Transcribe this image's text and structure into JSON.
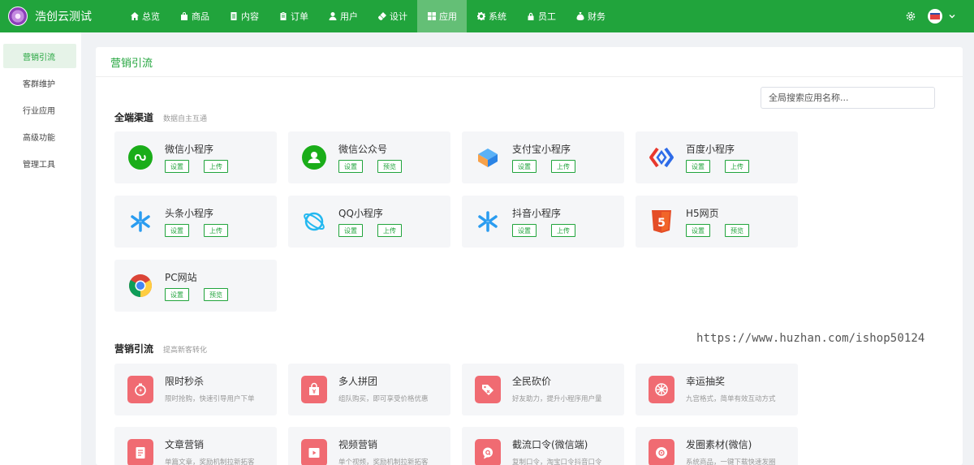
{
  "app": {
    "name": "浩创云测试"
  },
  "nav": [
    {
      "label": "总览",
      "icon": "home-icon"
    },
    {
      "label": "商品",
      "icon": "bag-icon"
    },
    {
      "label": "内容",
      "icon": "document-icon"
    },
    {
      "label": "订单",
      "icon": "clipboard-icon"
    },
    {
      "label": "用户",
      "icon": "user-icon"
    },
    {
      "label": "设计",
      "icon": "brush-icon"
    },
    {
      "label": "应用",
      "icon": "grid-icon",
      "active": true
    },
    {
      "label": "系统",
      "icon": "gear-icon"
    },
    {
      "label": "员工",
      "icon": "lock-icon"
    },
    {
      "label": "财务",
      "icon": "moneybag-icon"
    }
  ],
  "sidebar": [
    {
      "label": "营销引流",
      "active": true
    },
    {
      "label": "客群维护"
    },
    {
      "label": "行业应用"
    },
    {
      "label": "高级功能"
    },
    {
      "label": "管理工具"
    }
  ],
  "main": {
    "title": "营销引流",
    "search_placeholder": "全局搜索应用名称..."
  },
  "channels": {
    "title": "全端渠道",
    "subtitle": "数据自主互通",
    "items": [
      {
        "name": "微信小程序",
        "icon": "wechat-miniprogram-icon",
        "b1": "设置",
        "b2": "上传"
      },
      {
        "name": "微信公众号",
        "icon": "wechat-official-account-icon",
        "b1": "设置",
        "b2": "预览"
      },
      {
        "name": "支付宝小程序",
        "icon": "alipay-miniprogram-icon",
        "b1": "设置",
        "b2": "上传"
      },
      {
        "name": "百度小程序",
        "icon": "baidu-miniprogram-icon",
        "b1": "设置",
        "b2": "上传"
      },
      {
        "name": "头条小程序",
        "icon": "toutiao-miniprogram-icon",
        "b1": "设置",
        "b2": "上传"
      },
      {
        "name": "QQ小程序",
        "icon": "qq-miniprogram-icon",
        "b1": "设置",
        "b2": "上传"
      },
      {
        "name": "抖音小程序",
        "icon": "douyin-miniprogram-icon",
        "b1": "设置",
        "b2": "上传"
      },
      {
        "name": "H5网页",
        "icon": "html5-icon",
        "b1": "设置",
        "b2": "预览"
      },
      {
        "name": "PC网站",
        "icon": "chrome-icon",
        "b1": "设置",
        "b2": "预览"
      }
    ]
  },
  "marketing": {
    "title": "营销引流",
    "subtitle": "提高新客转化",
    "items": [
      {
        "name": "限时秒杀",
        "desc": "限时抢购，快速引导用户下单",
        "icon": "stopwatch-icon"
      },
      {
        "name": "多人拼团",
        "desc": "组队购买，即可享受价格优惠",
        "icon": "group-buy-icon"
      },
      {
        "name": "全民砍价",
        "desc": "好友助力，提升小程序用户量",
        "icon": "price-tag-icon"
      },
      {
        "name": "幸运抽奖",
        "desc": "九宫格式，简单有效互动方式",
        "icon": "lottery-icon"
      },
      {
        "name": "文章营销",
        "desc": "单篇文章，奖励机制拉新拓客",
        "icon": "article-icon"
      },
      {
        "name": "视频营销",
        "desc": "单个视频，奖励机制拉新拓客",
        "icon": "video-icon"
      },
      {
        "name": "截流口令(微信端)",
        "desc": "复制口令，淘宝口令抖音口令",
        "icon": "password-icon"
      },
      {
        "name": "发圈素材(微信)",
        "desc": "系统商品，一键下载快速发圈",
        "icon": "material-icon"
      }
    ]
  },
  "watermark": "https://www.huzhan.com/ishop50124"
}
